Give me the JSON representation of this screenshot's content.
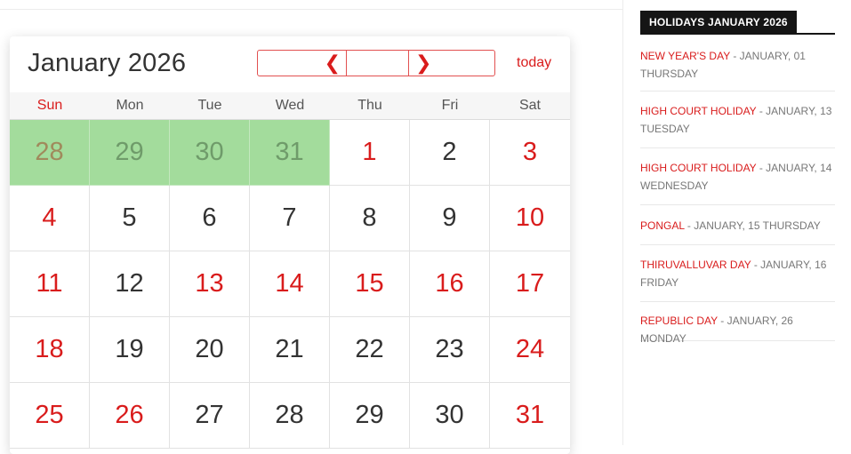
{
  "calendar": {
    "month_title": "January 2026",
    "nav_prev": "❮",
    "nav_next": "❯",
    "today_label": "today",
    "weekdays": [
      "Sun",
      "Mon",
      "Tue",
      "Wed",
      "Thu",
      "Fri",
      "Sat"
    ],
    "weeks": [
      [
        {
          "d": "28",
          "t": "other"
        },
        {
          "d": "29",
          "t": "other"
        },
        {
          "d": "30",
          "t": "other"
        },
        {
          "d": "31",
          "t": "other"
        },
        {
          "d": "1",
          "t": "red"
        },
        {
          "d": "2",
          "t": ""
        },
        {
          "d": "3",
          "t": "red"
        }
      ],
      [
        {
          "d": "4",
          "t": "red"
        },
        {
          "d": "5",
          "t": ""
        },
        {
          "d": "6",
          "t": ""
        },
        {
          "d": "7",
          "t": ""
        },
        {
          "d": "8",
          "t": ""
        },
        {
          "d": "9",
          "t": ""
        },
        {
          "d": "10",
          "t": "red"
        }
      ],
      [
        {
          "d": "11",
          "t": "red"
        },
        {
          "d": "12",
          "t": ""
        },
        {
          "d": "13",
          "t": "red"
        },
        {
          "d": "14",
          "t": "red"
        },
        {
          "d": "15",
          "t": "red"
        },
        {
          "d": "16",
          "t": "red"
        },
        {
          "d": "17",
          "t": "red"
        }
      ],
      [
        {
          "d": "18",
          "t": "red"
        },
        {
          "d": "19",
          "t": ""
        },
        {
          "d": "20",
          "t": ""
        },
        {
          "d": "21",
          "t": ""
        },
        {
          "d": "22",
          "t": ""
        },
        {
          "d": "23",
          "t": ""
        },
        {
          "d": "24",
          "t": "red"
        }
      ],
      [
        {
          "d": "25",
          "t": "red"
        },
        {
          "d": "26",
          "t": "red"
        },
        {
          "d": "27",
          "t": ""
        },
        {
          "d": "28",
          "t": ""
        },
        {
          "d": "29",
          "t": ""
        },
        {
          "d": "30",
          "t": ""
        },
        {
          "d": "31",
          "t": "red"
        }
      ]
    ]
  },
  "sidebar": {
    "heading": "HOLIDAYS JANUARY 2026",
    "holidays": [
      {
        "name": "NEW YEAR'S DAY",
        "detail": " - JANUARY, 01",
        "day": "THURSDAY"
      },
      {
        "name": "HIGH COURT HOLIDAY",
        "detail": " - JANUARY, 13",
        "day": "TUESDAY"
      },
      {
        "name": "HIGH COURT HOLIDAY",
        "detail": " - JANUARY, 14",
        "day": "WEDNESDAY"
      },
      {
        "name": "PONGAL",
        "detail": " - JANUARY, 15 THURSDAY",
        "day": ""
      },
      {
        "name": "THIRUVALLUVAR DAY",
        "detail": " - JANUARY, 16",
        "day": "FRIDAY"
      },
      {
        "name": "REPUBLIC DAY",
        "detail": " - JANUARY, 26 MONDAY",
        "day": ""
      }
    ]
  },
  "colors": {
    "accent": "#d91c1c",
    "other_month_bg": "#a3dc9c",
    "heading_bg": "#151515"
  }
}
